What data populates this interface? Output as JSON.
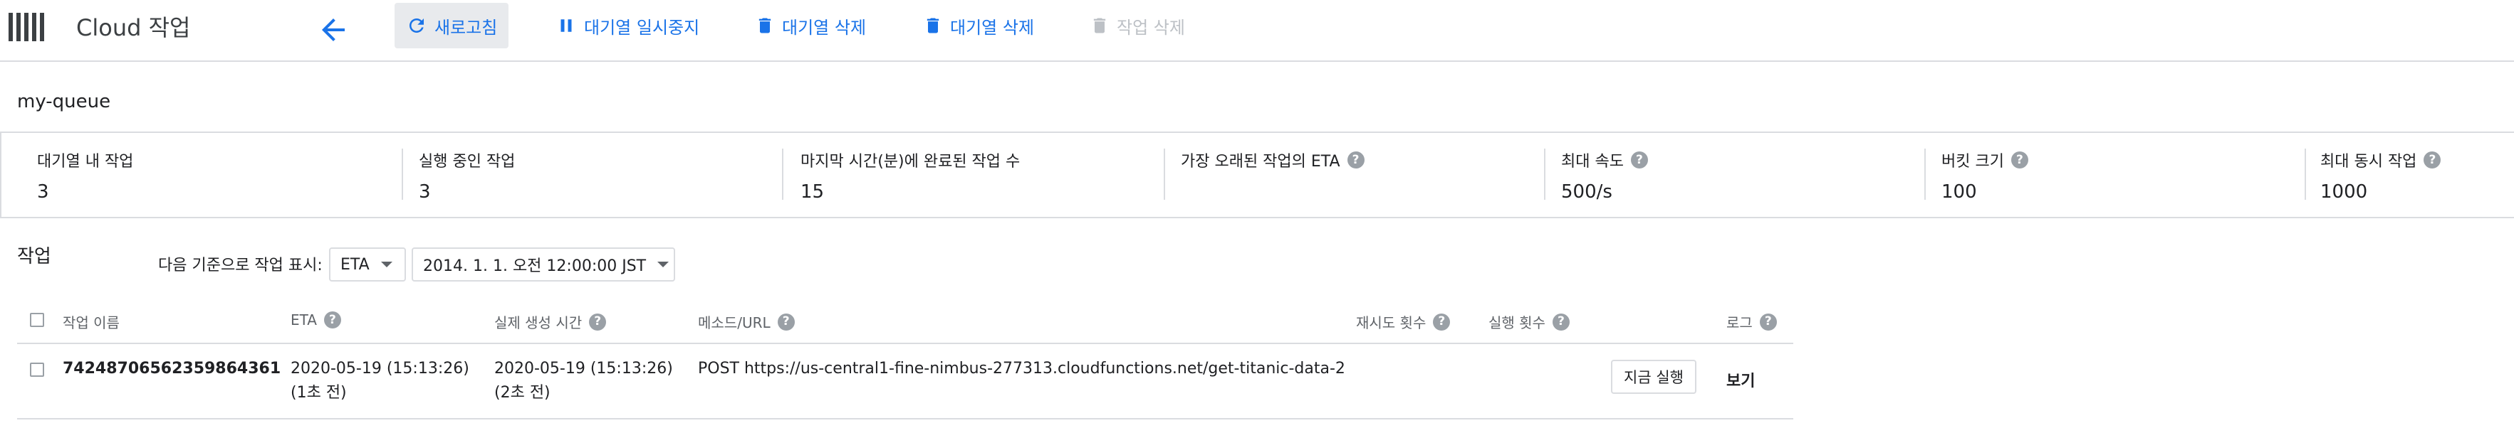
{
  "app": {
    "title": "Cloud 작업"
  },
  "toolbar": {
    "refresh_label": "새로고침",
    "pause_label": "대기열 일시중지",
    "delete_queue_label": "대기열 삭제",
    "purge_queue_label": "대기열 삭제",
    "delete_task_label": "작업 삭제"
  },
  "queue": {
    "name": "my-queue",
    "stats": [
      {
        "label": "대기열 내 작업",
        "value": "3",
        "help": false
      },
      {
        "label": "실행 중인 작업",
        "value": "3",
        "help": false
      },
      {
        "label": "마지막 시간(분)에 완료된 작업 수",
        "value": "15",
        "help": false
      },
      {
        "label": "가장 오래된 작업의 ETA",
        "value": "",
        "help": true
      },
      {
        "label": "최대 속도",
        "value": "500/s",
        "help": true
      },
      {
        "label": "버킷 크기",
        "value": "100",
        "help": true
      },
      {
        "label": "최대 동시 작업",
        "value": "1000",
        "help": true
      }
    ]
  },
  "tasks": {
    "title": "작업",
    "filter_label": "다음 기준으로 작업 표시:",
    "filter_field": "ETA",
    "filter_value": "2014. 1. 1. 오전 12:00:00 JST",
    "columns": {
      "name": "작업 이름",
      "eta": "ETA",
      "created": "실제 생성 시간",
      "method_url": "메소드/URL",
      "retries": "재시도 횟수",
      "executions": "실행 횟수",
      "log": "로그"
    },
    "rows": [
      {
        "name": "74248706562359864361",
        "eta": "2020-05-19 (15:13:26)",
        "eta_relative": "(1초 전)",
        "created": "2020-05-19 (15:13:26)",
        "created_relative": "(2초 전)",
        "method_url": "POST https://us-central1-fine-nimbus-277313.cloudfunctions.net/get-titanic-data-2",
        "retries": "",
        "executions": "",
        "run_now_label": "지금 실행",
        "log_label": "보기"
      }
    ]
  },
  "colors": {
    "accent": "#1a73e8",
    "text": "#202124",
    "muted": "#5f6368",
    "divider": "#dadce0",
    "disabled": "#bdc1c6"
  },
  "icons": [
    "app-logo-icon",
    "back-arrow-icon",
    "refresh-icon",
    "pause-icon",
    "trash-icon",
    "help-icon",
    "dropdown-caret-icon"
  ]
}
